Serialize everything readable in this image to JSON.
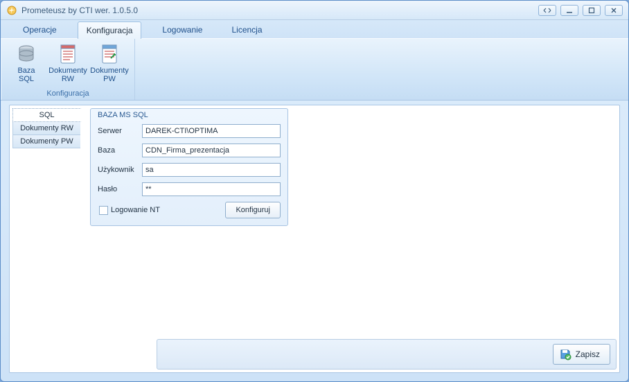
{
  "window": {
    "title": "Prometeusz by CTI  wer. 1.0.5.0"
  },
  "tabs": {
    "operacje": "Operacje",
    "konfiguracja": "Konfiguracja",
    "logowanie": "Logowanie",
    "licencja": "Licencja",
    "active": "konfiguracja"
  },
  "ribbon": {
    "group_title": "Konfiguracja",
    "items": [
      {
        "line1": "Baza",
        "line2": "SQL"
      },
      {
        "line1": "Dokumenty",
        "line2": "RW"
      },
      {
        "line1": "Dokumenty",
        "line2": "PW"
      }
    ]
  },
  "sideTabs": {
    "sql": "SQL",
    "rw": "Dokumenty RW",
    "pw": "Dokumenty PW",
    "active": "sql"
  },
  "group": {
    "title": "BAZA MS SQL",
    "labels": {
      "serwer": "Serwer",
      "baza": "Baza",
      "user": "Użykownik",
      "haslo": "Hasło",
      "logowanie_nt": "Logowanie NT"
    },
    "values": {
      "serwer": "DAREK-CTI\\OPTIMA",
      "baza": "CDN_Firma_prezentacja",
      "user": "sa",
      "haslo": "**"
    },
    "konfiguruj": "Konfiguruj"
  },
  "footer": {
    "zapisz": "Zapisz"
  }
}
